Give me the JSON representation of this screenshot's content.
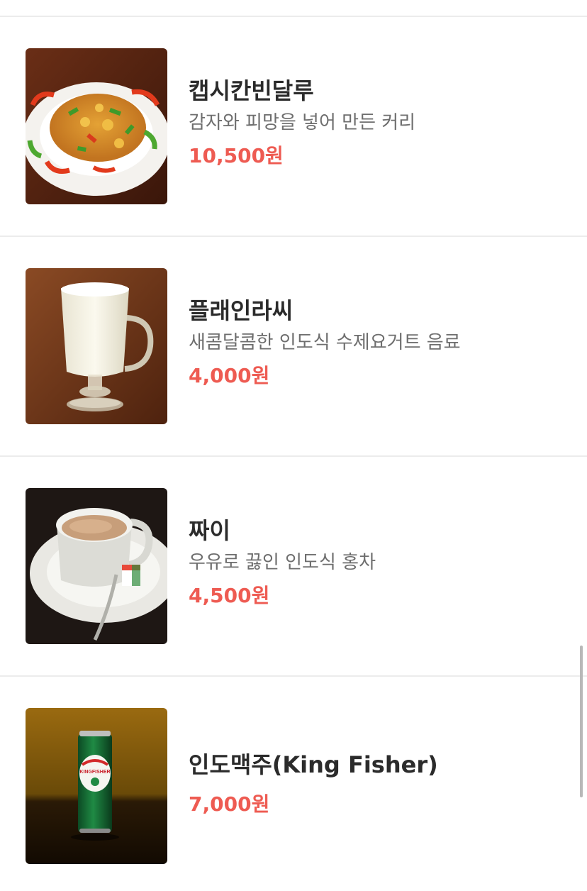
{
  "menu": {
    "items": [
      {
        "name": "캡시칸빈달루",
        "description": "감자와 피망을 넣어 만든 커리",
        "price": "10,500원",
        "image_icon": "curry-plate-photo"
      },
      {
        "name": "플래인라씨",
        "description": "새콤달콤한 인도식 수제요거트 음료",
        "price": "4,000원",
        "image_icon": "lassi-glass-photo"
      },
      {
        "name": "짜이",
        "description": "우유로 끓인 인도식 홍차",
        "price": "4,500원",
        "image_icon": "chai-cup-photo"
      },
      {
        "name": "인도맥주(King Fisher)",
        "description": "",
        "price": "7,000원",
        "image_icon": "beer-can-photo",
        "image_text": "KINGFISHER"
      }
    ]
  },
  "colors": {
    "price": "#ee5b52",
    "name": "#2b2b2b",
    "description": "#6e6e6e",
    "divider": "#ececec"
  }
}
